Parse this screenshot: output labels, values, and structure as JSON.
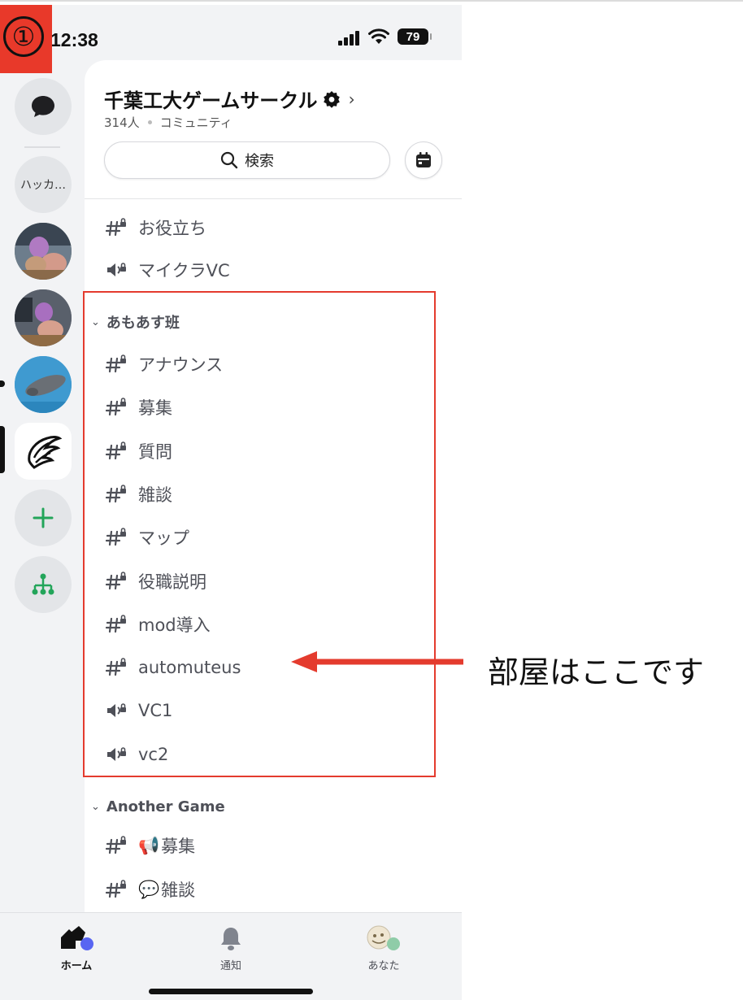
{
  "step_badge": "①",
  "status_bar": {
    "time": "12:38",
    "battery": "79"
  },
  "guild_sidebar": {
    "folder_label": "ハッカ…",
    "items": [
      {
        "name": "messages"
      },
      {
        "name": "folder"
      },
      {
        "name": "server-avatar-1"
      },
      {
        "name": "server-avatar-2"
      },
      {
        "name": "server-avatar-3"
      },
      {
        "name": "server-selected"
      },
      {
        "name": "add-server"
      },
      {
        "name": "discover"
      }
    ]
  },
  "server": {
    "title": "千葉工大ゲームサークル",
    "members": "314人",
    "type": "コミュニティ",
    "search_label": "検索"
  },
  "channels_top": [
    {
      "icon": "text",
      "name": "お役立ち"
    },
    {
      "icon": "voice",
      "name": "マイクラVC"
    }
  ],
  "category_1": {
    "name": "あもあす班",
    "channels": [
      {
        "icon": "text",
        "name": "アナウンス"
      },
      {
        "icon": "text",
        "name": "募集"
      },
      {
        "icon": "text",
        "name": "質問"
      },
      {
        "icon": "text",
        "name": "雑談"
      },
      {
        "icon": "text",
        "name": "マップ"
      },
      {
        "icon": "text",
        "name": "役職説明"
      },
      {
        "icon": "text",
        "name": "mod導入"
      },
      {
        "icon": "text",
        "name": "automuteus"
      },
      {
        "icon": "voice",
        "name": "VC1"
      },
      {
        "icon": "voice",
        "name": "vc2"
      }
    ]
  },
  "category_2": {
    "name": "Another Game",
    "channels": [
      {
        "icon": "text",
        "emoji": "📢",
        "name": "募集"
      },
      {
        "icon": "text",
        "emoji": "💬",
        "name": "雑談"
      }
    ]
  },
  "tabbar": {
    "home": "ホーム",
    "notifications": "通知",
    "you": "あなた"
  },
  "annotation": {
    "text": "部屋はここです"
  },
  "colors": {
    "accent_red": "#e43b2e",
    "status_blurple": "#5865f2",
    "status_green": "#23a55a"
  }
}
